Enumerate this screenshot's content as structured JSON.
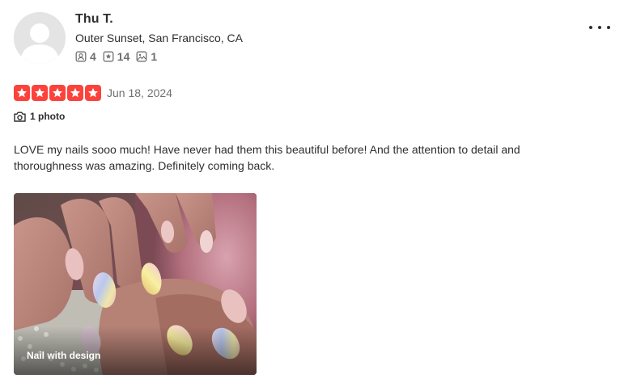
{
  "user": {
    "name": "Thu T.",
    "location": "Outer Sunset, San Francisco, CA",
    "friends": "4",
    "reviews": "14",
    "photos": "1"
  },
  "review": {
    "rating": 5,
    "rating_max": 5,
    "date": "Jun 18, 2024",
    "photo_count_label": "1 photo",
    "text": "LOVE my nails sooo much! Have never had them this beautiful before! And the attention to detail and thoroughness was amazing. Definitely coming back.",
    "photo": {
      "caption": "Nail with design"
    }
  },
  "colors": {
    "star": "#fb433c",
    "text": "#2d2e2f",
    "muted": "#6e7072"
  },
  "icons": {
    "friends": "friends-icon",
    "reviews": "reviews-star-icon",
    "photos": "photo-icon",
    "camera": "camera-icon",
    "more": "more-options-icon"
  }
}
